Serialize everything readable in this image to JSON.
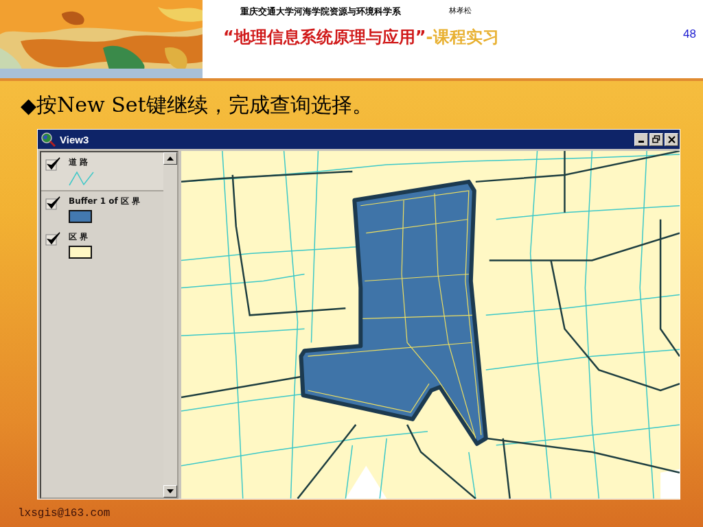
{
  "header": {
    "department": "重庆交通大学河海学院资源与环境科学系",
    "author": "林孝松",
    "title": "“地理信息系统原理与应用”",
    "subtitle": "-课程实习",
    "page_number": "48"
  },
  "bullet": {
    "marker": "◆",
    "text": "按New Set键继续，完成查询选择。"
  },
  "window": {
    "title": "View3"
  },
  "legend": [
    {
      "label": "道 路",
      "checked": true,
      "selected": true,
      "kind": "line",
      "color": "#3cc8c8"
    },
    {
      "label": "Buffer 1 of 区 界",
      "checked": true,
      "selected": false,
      "kind": "fill",
      "color": "#4379b0"
    },
    {
      "label": "区 界",
      "checked": true,
      "selected": false,
      "kind": "fill",
      "color": "#fff7c4"
    }
  ],
  "footer": {
    "email": "lxsgis@163.com"
  }
}
